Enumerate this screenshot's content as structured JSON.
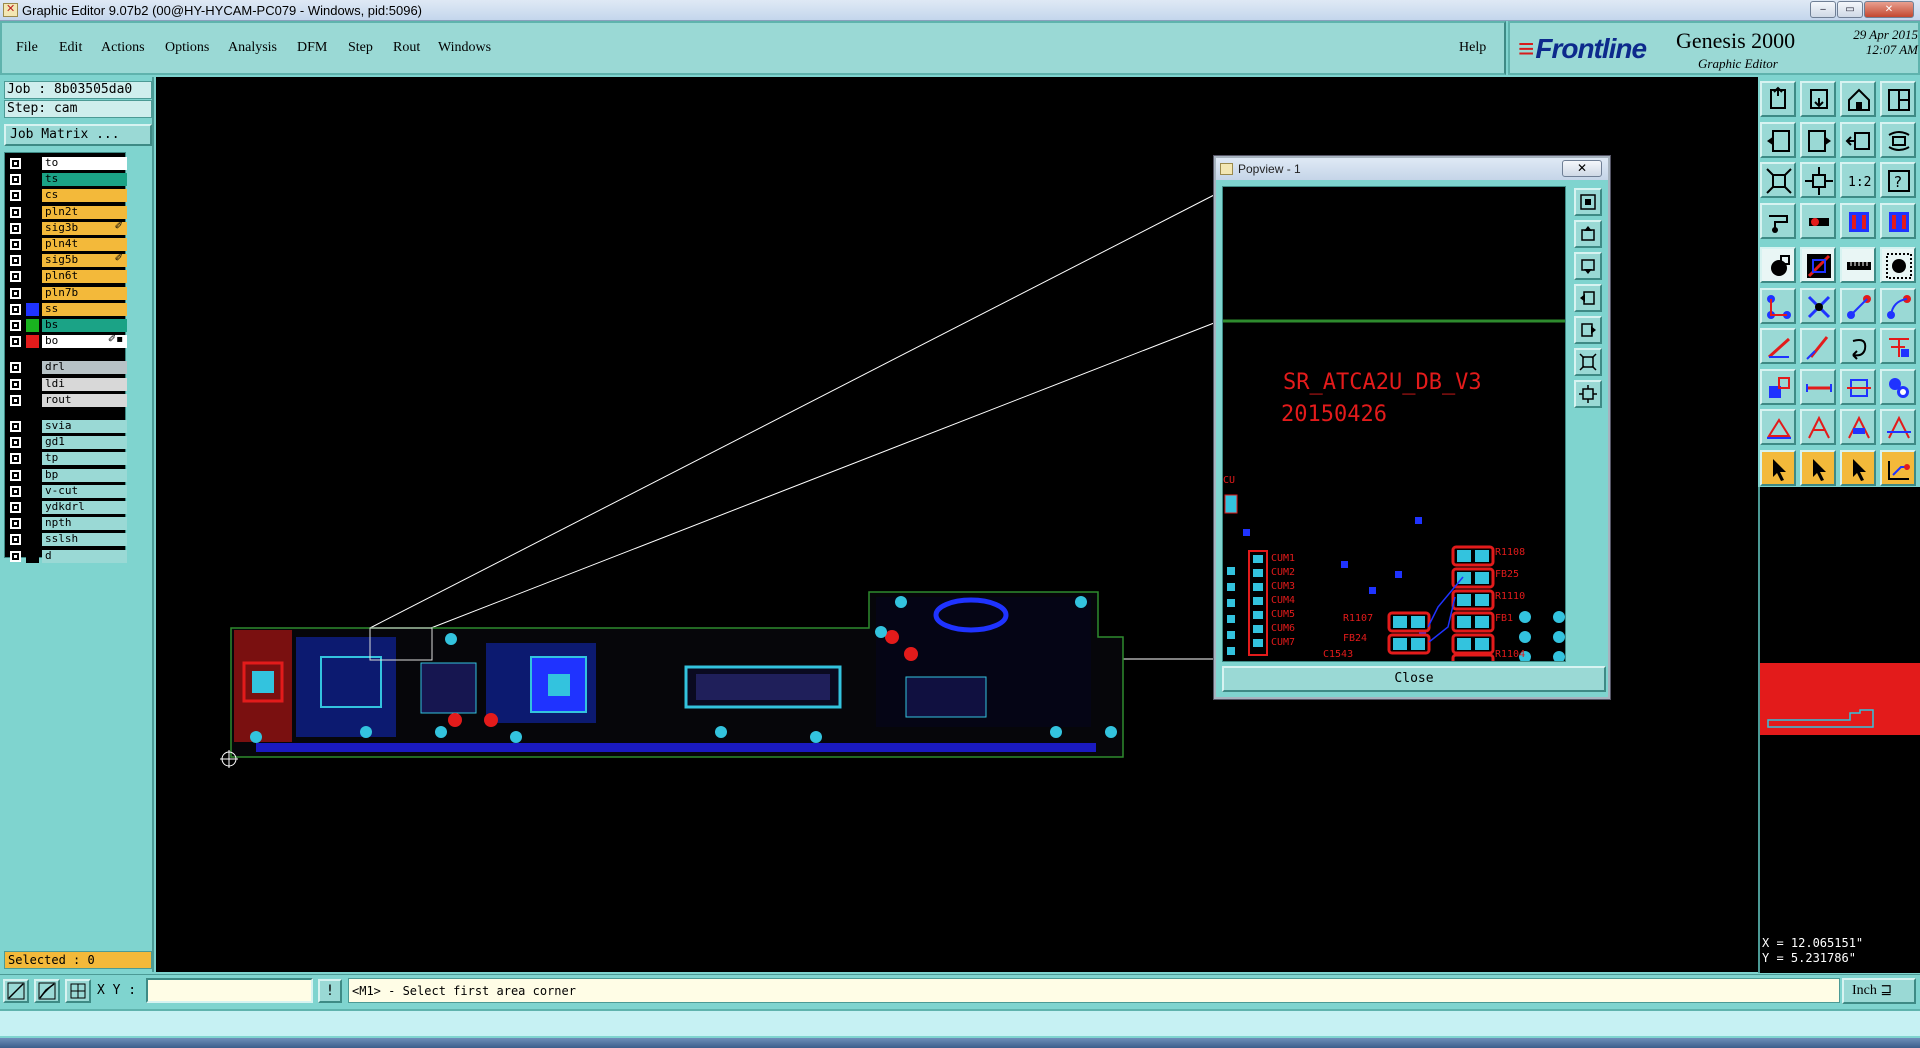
{
  "window": {
    "title": "Graphic Editor 9.07b2 (00@HY-HYCAM-PC079 - Windows, pid:5096)",
    "minimize": "‒",
    "maximize": "▭",
    "close": "✕"
  },
  "menu": [
    "File",
    "Edit",
    "Actions",
    "Options",
    "Analysis",
    "DFM",
    "Step",
    "Rout",
    "Windows"
  ],
  "help": "Help",
  "brand": {
    "logo": "Frontline",
    "product": "Genesis 2000",
    "subtitle": "Graphic Editor",
    "date": "29 Apr 2015",
    "time": "12:07 AM"
  },
  "job": "Job : 8b03505da0",
  "step": "Step: cam",
  "job_matrix": "Job Matrix ...",
  "layers": [
    {
      "name": "to",
      "bg": "#ffffff",
      "swatch": "#000000",
      "flag": ""
    },
    {
      "name": "ts",
      "bg": "#1ba386",
      "swatch": "#000000",
      "flag": ""
    },
    {
      "name": "cs",
      "bg": "#f3b93a",
      "swatch": "#000000",
      "flag": ""
    },
    {
      "name": "pln2t",
      "bg": "#f3b93a",
      "swatch": "#000000",
      "flag": ""
    },
    {
      "name": "sig3b",
      "bg": "#f3b93a",
      "swatch": "#000000",
      "flag": "✐"
    },
    {
      "name": "pln4t",
      "bg": "#f3b93a",
      "swatch": "#000000",
      "flag": ""
    },
    {
      "name": "sig5b",
      "bg": "#f3b93a",
      "swatch": "#000000",
      "flag": "✐"
    },
    {
      "name": "pln6t",
      "bg": "#f3b93a",
      "swatch": "#000000",
      "flag": ""
    },
    {
      "name": "pln7b",
      "bg": "#f3b93a",
      "swatch": "#000000",
      "flag": ""
    },
    {
      "name": "ss",
      "bg": "#f3b93a",
      "swatch": "#1f33ff",
      "flag": ""
    },
    {
      "name": "bs",
      "bg": "#1ba386",
      "swatch": "#19b21f",
      "flag": ""
    },
    {
      "name": "bo",
      "bg": "#ffffff",
      "swatch": "#e31b1b",
      "flag": "✐▪"
    },
    {
      "name": "drl",
      "bg": "#b7c2c6",
      "swatch": "#000000",
      "flag": ""
    },
    {
      "name": "ldi",
      "bg": "#d8d8d8",
      "swatch": "#000000",
      "flag": ""
    },
    {
      "name": "rout",
      "bg": "#d8d8d8",
      "swatch": "#000000",
      "flag": ""
    },
    {
      "name": "svia",
      "bg": "#9ad9d5",
      "swatch": "#000000",
      "flag": ""
    },
    {
      "name": "gd1",
      "bg": "#9ad9d5",
      "swatch": "#000000",
      "flag": ""
    },
    {
      "name": "tp",
      "bg": "#9ad9d5",
      "swatch": "#000000",
      "flag": ""
    },
    {
      "name": "bp",
      "bg": "#9ad9d5",
      "swatch": "#000000",
      "flag": ""
    },
    {
      "name": "v-cut",
      "bg": "#9ad9d5",
      "swatch": "#000000",
      "flag": ""
    },
    {
      "name": "ydkdrl",
      "bg": "#9ad9d5",
      "swatch": "#000000",
      "flag": ""
    },
    {
      "name": "npth",
      "bg": "#9ad9d5",
      "swatch": "#000000",
      "flag": ""
    },
    {
      "name": "sslsh",
      "bg": "#9ad9d5",
      "swatch": "#000000",
      "flag": ""
    },
    {
      "name": "d",
      "bg": "#9ad9d5",
      "swatch": "#000000",
      "flag": ""
    }
  ],
  "selected": "Selected : 0",
  "popview": {
    "title": "Popview - 1",
    "close_x": "✕",
    "board_name": "SR_ATCA2U_DB_V3",
    "board_date": "20150426",
    "close": "Close",
    "refs_left": [
      "CUM1",
      "CUM2",
      "CUM3",
      "CUM4",
      "CUM5",
      "CUM6",
      "CUM7"
    ],
    "refs_right": [
      "R1108",
      "FB25",
      "R1110",
      "FB1",
      "R1107",
      "FB24",
      "C1543",
      "R1104"
    ],
    "ref_cu": "CU"
  },
  "coords": {
    "x": "X = 12.065151\"",
    "y": "Y = 5.231786\""
  },
  "bottom": {
    "xy_label": "X Y :",
    "xy_value": "",
    "prompt_btn": "!",
    "prompt": "<M1> - Select first area corner",
    "unit": "Inch ⊒"
  },
  "colors": {
    "panel": "#7fd4cf",
    "pad": "#33c3de",
    "copper_red": "#e31b1b",
    "trace_blue": "#1f33ff",
    "outline_green": "#2e8b2e"
  }
}
